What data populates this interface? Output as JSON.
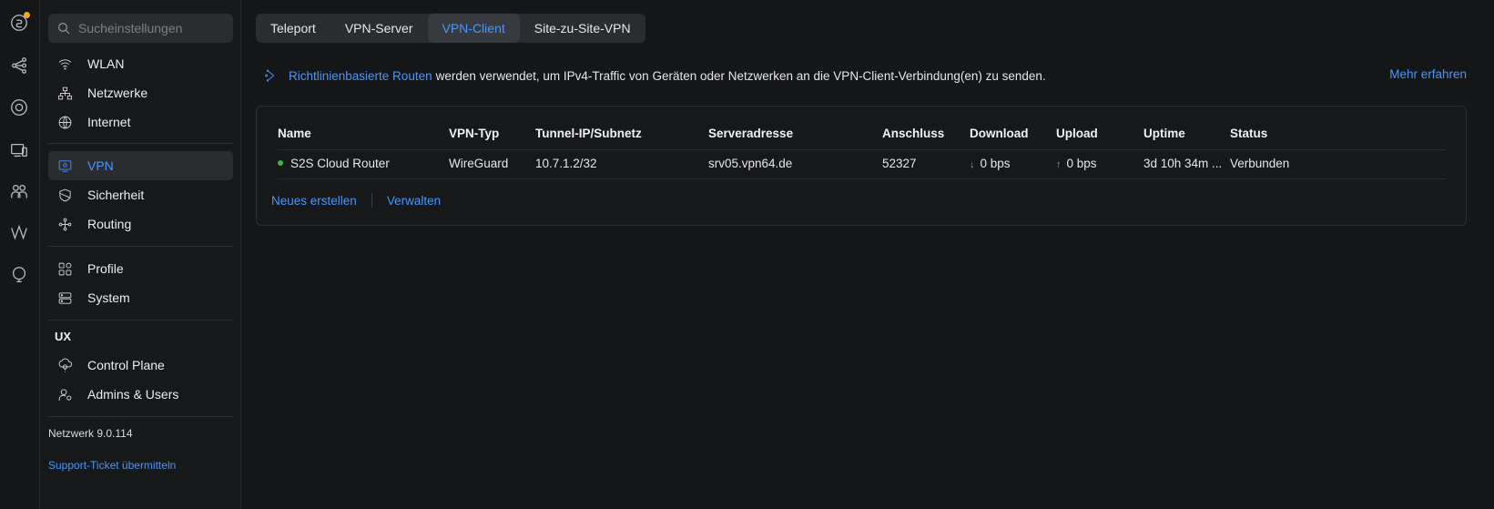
{
  "rail": {
    "icons": [
      "dashboard-icon",
      "topology-icon",
      "devices-icon",
      "device-list-icon",
      "clients-icon",
      "insights-icon",
      "integrations-icon"
    ]
  },
  "sidebar": {
    "search_placeholder": "Sucheinstellungen",
    "items": [
      {
        "label": "WLAN",
        "icon": "wifi-icon"
      },
      {
        "label": "Netzwerke",
        "icon": "network-icon"
      },
      {
        "label": "Internet",
        "icon": "globe-icon"
      },
      {
        "label": "VPN",
        "icon": "vpn-icon",
        "active": true
      },
      {
        "label": "Sicherheit",
        "icon": "shield-icon"
      },
      {
        "label": "Routing",
        "icon": "routing-icon"
      },
      {
        "label": "Profile",
        "icon": "profiles-icon"
      },
      {
        "label": "System",
        "icon": "system-icon"
      }
    ],
    "section_ux": "UX",
    "ux_items": [
      {
        "label": "Control Plane",
        "icon": "control-plane-icon"
      },
      {
        "label": "Admins & Users",
        "icon": "admins-icon"
      }
    ],
    "version": "Netzwerk 9.0.114",
    "support": "Support-Ticket übermitteln"
  },
  "tabs": [
    {
      "label": "Teleport"
    },
    {
      "label": "VPN-Server"
    },
    {
      "label": "VPN-Client",
      "active": true
    },
    {
      "label": "Site-zu-Site-VPN"
    }
  ],
  "info": {
    "link": "Richtlinienbasierte Routen",
    "text": "werden verwendet, um IPv4-Traffic von Geräten oder Netzwerken an die VPN-Client-Verbindung(en) zu senden.",
    "more": "Mehr erfahren"
  },
  "table": {
    "headers": [
      "Name",
      "VPN-Typ",
      "Tunnel-IP/Subnetz",
      "Serveradresse",
      "Anschluss",
      "Download",
      "Upload",
      "Uptime",
      "Status"
    ],
    "rows": [
      {
        "name": "S2S Cloud Router",
        "type": "WireGuard",
        "tunnel": "10.7.1.2/32",
        "server": "srv05.vpn64.de",
        "port": "52327",
        "download": "0 bps",
        "upload": "0 bps",
        "uptime": "3d 10h 34m ...",
        "status": "Verbunden"
      }
    ],
    "download_arrow": "↓",
    "upload_arrow": "↑"
  },
  "actions": {
    "create": "Neues erstellen",
    "manage": "Verwalten"
  },
  "colors": {
    "accent": "#4797ff",
    "status_connected": "#39b54a",
    "notification": "#f5a623"
  }
}
